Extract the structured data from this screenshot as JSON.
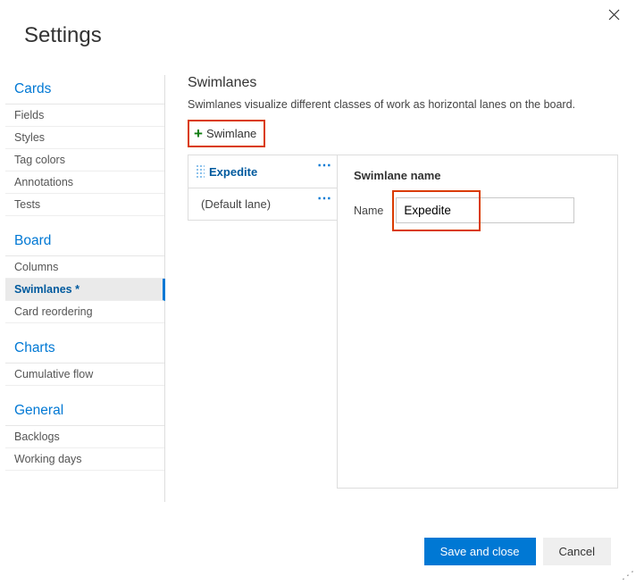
{
  "header": {
    "title": "Settings"
  },
  "sidebar": {
    "sections": [
      {
        "title": "Cards",
        "items": [
          {
            "label": "Fields",
            "active": false
          },
          {
            "label": "Styles",
            "active": false
          },
          {
            "label": "Tag colors",
            "active": false
          },
          {
            "label": "Annotations",
            "active": false
          },
          {
            "label": "Tests",
            "active": false
          }
        ]
      },
      {
        "title": "Board",
        "items": [
          {
            "label": "Columns",
            "active": false
          },
          {
            "label": "Swimlanes *",
            "active": true
          },
          {
            "label": "Card reordering",
            "active": false
          }
        ]
      },
      {
        "title": "Charts",
        "items": [
          {
            "label": "Cumulative flow",
            "active": false
          }
        ]
      },
      {
        "title": "General",
        "items": [
          {
            "label": "Backlogs",
            "active": false
          },
          {
            "label": "Working days",
            "active": false
          }
        ]
      }
    ]
  },
  "main": {
    "title": "Swimlanes",
    "description": "Swimlanes visualize different classes of work as horizontal lanes on the board.",
    "add_button": "Swimlane",
    "lanes": [
      {
        "label": "Expedite",
        "active": true
      },
      {
        "label": "(Default lane)",
        "active": false
      }
    ],
    "detail": {
      "title": "Swimlane name",
      "name_label": "Name",
      "name_value": "Expedite"
    }
  },
  "footer": {
    "save": "Save and close",
    "cancel": "Cancel"
  }
}
